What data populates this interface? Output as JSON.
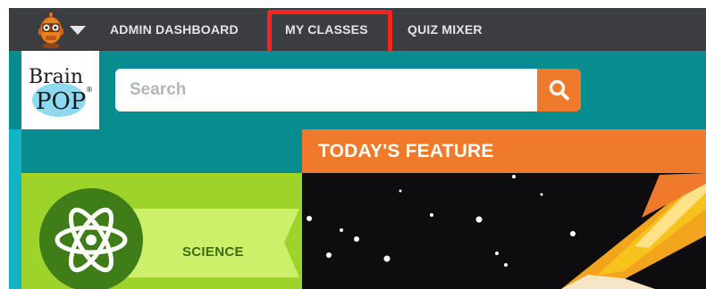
{
  "topnav": {
    "menu_items": [
      {
        "label": "ADMIN DASHBOARD"
      },
      {
        "label": "MY CLASSES",
        "highlighted": true
      },
      {
        "label": "QUIZ MIXER"
      }
    ],
    "avatar_icon": "robot-moby-icon",
    "dropdown_icon": "caret-down-icon",
    "highlight_color": "#f0281c"
  },
  "header": {
    "logo": {
      "text_line1": "Brain",
      "text_line2": "POP",
      "mark": "®"
    },
    "search": {
      "placeholder": "Search",
      "value": "",
      "button_icon": "search-icon"
    }
  },
  "main": {
    "category": {
      "label": "SCIENCE",
      "icon": "atom-icon"
    },
    "feature": {
      "title": "TODAY'S FEATURE"
    }
  },
  "colors": {
    "nav_bg": "#3b3d40",
    "teal": "#078c8f",
    "accent_orange": "#f07a2c",
    "science_green": "#9ed32b",
    "science_dark": "#3f7d18"
  }
}
